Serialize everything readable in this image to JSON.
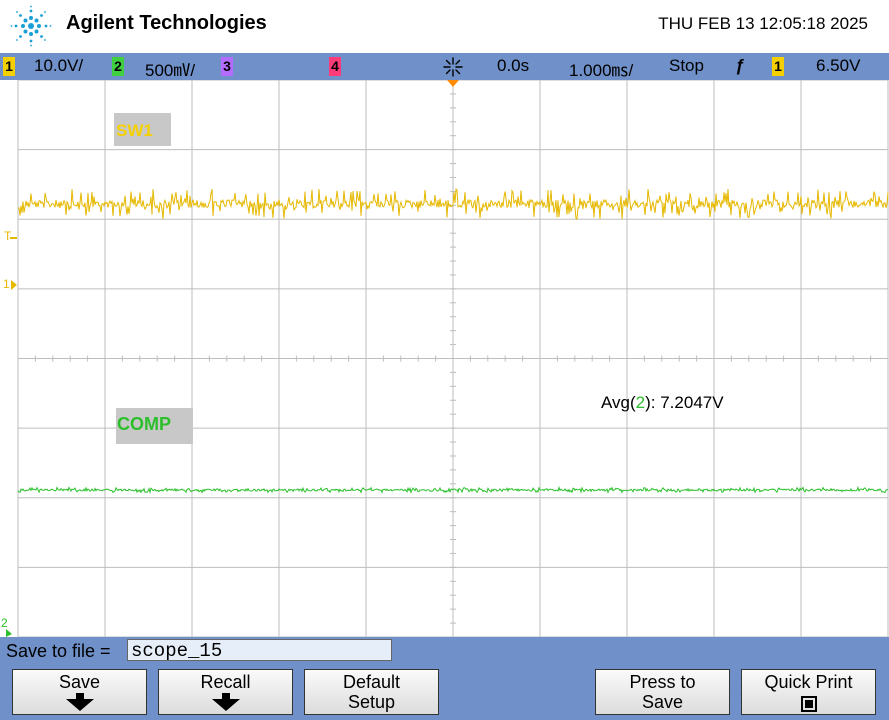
{
  "header": {
    "brand": "Agilent Technologies",
    "datetime": "THU FEB 13 12:05:18 2025"
  },
  "status": {
    "ch1_num": "1",
    "ch1_scale": "10.0V/",
    "ch2_num": "2",
    "ch2_scale": "500㎷/",
    "ch3_num": "3",
    "ch4_num": "4",
    "delay": "0.0s",
    "timebase": "1.000㎳/",
    "run_state": "Stop",
    "trig_slope": "ƒ",
    "trig_src": "1",
    "trig_level": "6.50V"
  },
  "colors": {
    "ch1": "#e6b800",
    "ch2": "#2bc02b",
    "ch3": "#a64dff",
    "ch4": "#ff2a6a",
    "grid": "#bdbdbd",
    "panel": "#6f90c8"
  },
  "scope": {
    "label_sw1": "SW1",
    "label_comp": "COMP",
    "measure_prefix": "Avg(",
    "measure_ch": "2",
    "measure_suffix": "): 7.2047V",
    "marker_trig": "T",
    "marker_ch1": "1",
    "marker_ch2": "2"
  },
  "savebar": {
    "label": "Save to file =",
    "filename": "scope_15"
  },
  "softkeys": {
    "save": "Save",
    "recall": "Recall",
    "default_l1": "Default",
    "default_l2": "Setup",
    "press_l1": "Press to",
    "press_l2": "Save",
    "quickprint": "Quick Print"
  }
}
